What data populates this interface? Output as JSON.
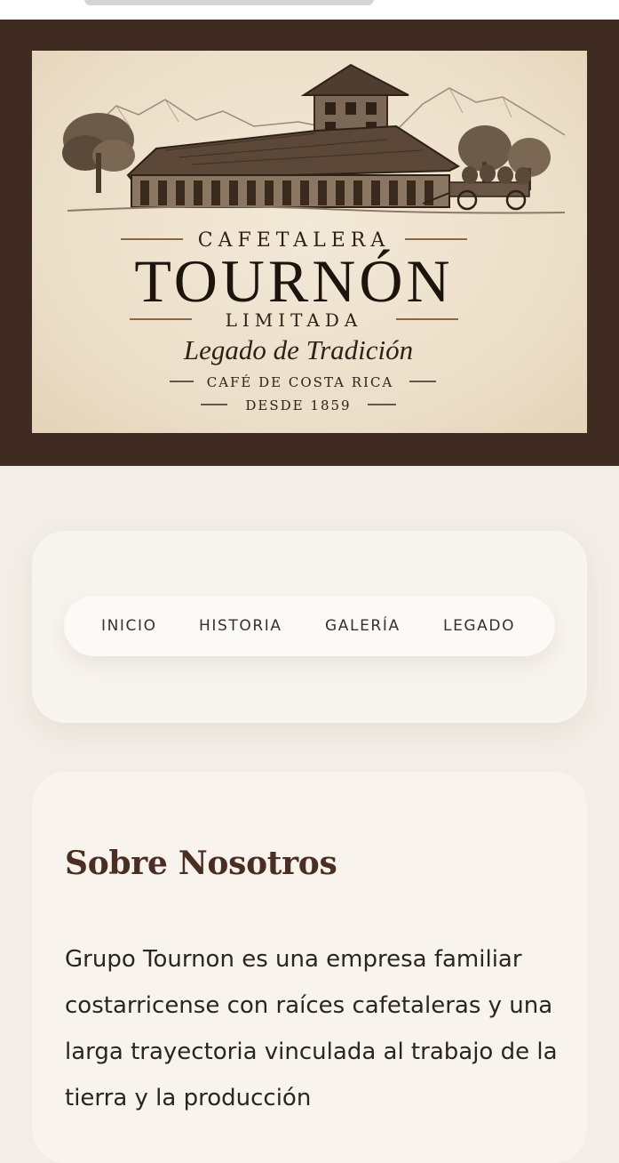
{
  "logo": {
    "line_top": "CAFETALERA",
    "name": "TOURNÓN",
    "line_mid": "LIMITADA",
    "tagline": "Legado de Tradición",
    "origin": "CAFÉ DE COSTA RICA",
    "since": "DESDE 1859"
  },
  "nav": {
    "items": [
      {
        "label": "INICIO"
      },
      {
        "label": "HISTORIA"
      },
      {
        "label": "GALERÍA"
      },
      {
        "label": "LEGADO"
      }
    ]
  },
  "about": {
    "title": "Sobre Nosotros",
    "text": "Grupo Tournon es una empresa familiar costarricense con raíces cafetaleras y una larga trayectoria vinculada al trabajo de la tierra y la producción"
  },
  "colors": {
    "hero_bg": "#3f2b21",
    "page_bg": "#f2ede6",
    "card_bg": "#f8f4ee",
    "title_brown": "#4a2e21"
  }
}
